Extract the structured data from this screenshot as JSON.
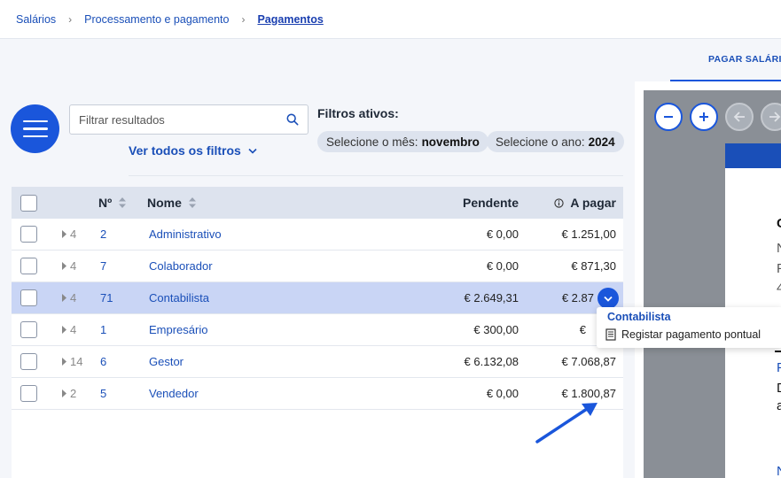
{
  "breadcrumb": {
    "items": [
      "Salários",
      "Processamento e pagamento"
    ],
    "current": "Pagamentos",
    "separator": "›"
  },
  "tabs": {
    "active": "PAGAR SALÁRIOS"
  },
  "search": {
    "placeholder": "Filtrar resultados",
    "value": ""
  },
  "filters": {
    "see_all_label": "Ver todos os filtros",
    "active_title": "Filtros ativos:",
    "chips": [
      {
        "label": "Selecione o mês:",
        "value": "novembro"
      },
      {
        "label": "Selecione o ano:",
        "value": "2024"
      }
    ]
  },
  "table": {
    "columns": {
      "num": "Nº",
      "name": "Nome",
      "pending": "Pendente",
      "to_pay": "A pagar"
    },
    "rows": [
      {
        "count": "4",
        "num": "2",
        "name": "Administrativo",
        "pending": "€ 0,00",
        "to_pay": "€ 1.251,00",
        "selected": false
      },
      {
        "count": "4",
        "num": "7",
        "name": "Colaborador",
        "pending": "€ 0,00",
        "to_pay": "€ 871,30",
        "selected": false
      },
      {
        "count": "4",
        "num": "71",
        "name": "Contabilista",
        "pending": "€ 2.649,31",
        "to_pay": "€ 2.87",
        "selected": true
      },
      {
        "count": "4",
        "num": "1",
        "name": "Empresário",
        "pending": "€ 300,00",
        "to_pay": "€",
        "selected": false
      },
      {
        "count": "14",
        "num": "6",
        "name": "Gestor",
        "pending": "€ 6.132,08",
        "to_pay": "€ 7.068,87",
        "selected": false
      },
      {
        "count": "2",
        "num": "5",
        "name": "Vendedor",
        "pending": "€ 0,00",
        "to_pay": "€ 1.800,87",
        "selected": false
      }
    ]
  },
  "popup": {
    "title": "Contabilista",
    "action": "Registar pagamento pontual"
  },
  "viewer": {
    "buttons": [
      "zoom-out",
      "zoom-in",
      "prev-page",
      "next-page"
    ],
    "doc_chars": [
      "C",
      "N",
      "F",
      "4",
      "F",
      "D",
      "a",
      "N"
    ]
  },
  "colors": {
    "accent": "#1a56db",
    "link": "#1a4fb8",
    "selected_row": "#c9d5f5",
    "header_bg": "#dde3ee"
  }
}
